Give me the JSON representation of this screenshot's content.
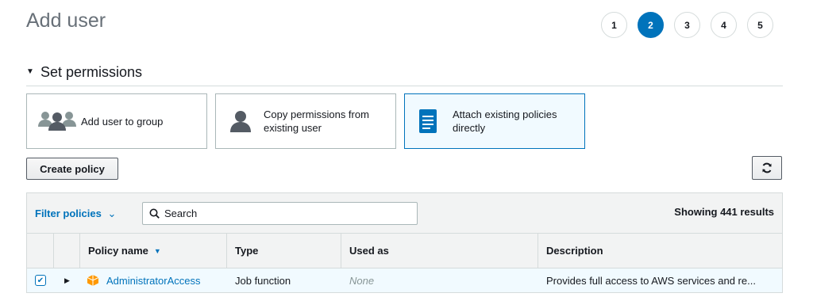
{
  "page": {
    "title": "Add user"
  },
  "steps": [
    "1",
    "2",
    "3",
    "4",
    "5"
  ],
  "active_step": "2",
  "section": {
    "title": "Set permissions"
  },
  "options": [
    {
      "label": "Add user to group",
      "icon": "group-icon",
      "selected": false
    },
    {
      "label_line1": "Copy permissions from",
      "label_line2": "existing user",
      "icon": "user-icon",
      "selected": false
    },
    {
      "label_line1": "Attach existing policies",
      "label_line2": "directly",
      "icon": "document-icon",
      "selected": true
    }
  ],
  "toolbar": {
    "create_policy_label": "Create policy",
    "refresh_icon": "refresh-icon"
  },
  "filter": {
    "label": "Filter policies",
    "search_placeholder": "Search",
    "showing": "Showing 441 results"
  },
  "table": {
    "columns": [
      "Policy name",
      "Type",
      "Used as",
      "Description"
    ],
    "rows": [
      {
        "checked": true,
        "name": "AdministratorAccess",
        "type": "Job function",
        "used_as": "None",
        "description": "Provides full access to AWS services and re..."
      }
    ]
  },
  "colors": {
    "accent": "#0073bb",
    "selected_bg": "#f1faff",
    "policy_icon": "#ff9900"
  }
}
